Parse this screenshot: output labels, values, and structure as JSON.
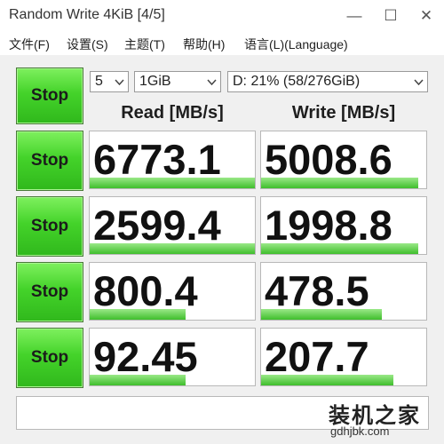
{
  "window": {
    "title": "Random Write 4KiB [4/5]",
    "controls": {
      "minimize": "—",
      "maximize": "☐",
      "close": "✕"
    }
  },
  "menu": {
    "items": [
      "文件(F)",
      "设置(S)",
      "主题(T)",
      "帮助(H)",
      "语言(L)(Language)"
    ]
  },
  "controls": {
    "all_button_label": "Stop",
    "count": "5",
    "size": "1GiB",
    "drive": "D: 21% (58/276GiB)"
  },
  "columns": {
    "read": "Read [MB/s]",
    "write": "Write [MB/s]"
  },
  "rows": [
    {
      "button_label": "Stop",
      "read": "6773.1",
      "write": "5008.6",
      "read_fill_pct": 100,
      "write_fill_pct": 95
    },
    {
      "button_label": "Stop",
      "read": "2599.4",
      "write": "1998.8",
      "read_fill_pct": 100,
      "write_fill_pct": 95
    },
    {
      "button_label": "Stop",
      "read": "800.4",
      "write": "478.5",
      "read_fill_pct": 58,
      "write_fill_pct": 73
    },
    {
      "button_label": "Stop",
      "read": "92.45",
      "write": "207.7",
      "read_fill_pct": 58,
      "write_fill_pct": 80
    }
  ],
  "status": {
    "text": ""
  },
  "watermark": {
    "name": "装机之家",
    "url": "gdhjbk.com"
  },
  "colors": {
    "accent_green": "#44d32a",
    "bar_green": "#3fbe2c"
  },
  "icons": {
    "dropdown": "chevron-down-icon"
  }
}
